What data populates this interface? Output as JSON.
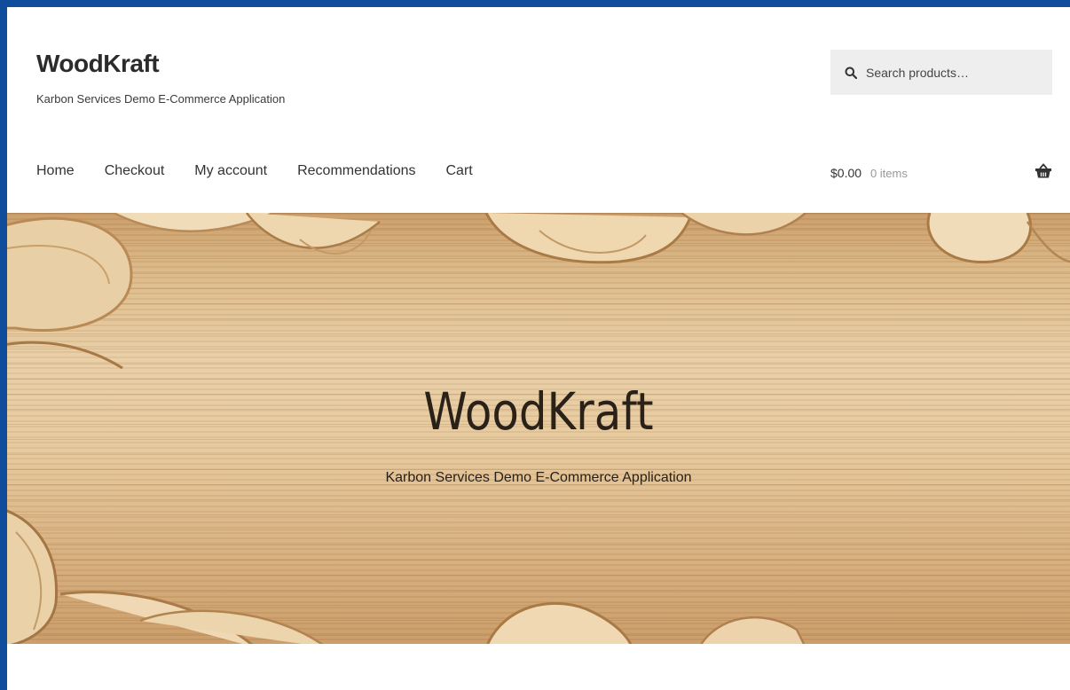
{
  "site": {
    "title": "WoodKraft",
    "description": "Karbon Services Demo E-Commerce Application"
  },
  "search": {
    "placeholder": "Search products…",
    "icon": "search-icon"
  },
  "nav": {
    "items": [
      {
        "label": "Home"
      },
      {
        "label": "Checkout"
      },
      {
        "label": "My account"
      },
      {
        "label": "Recommendations"
      },
      {
        "label": "Cart"
      }
    ]
  },
  "cart": {
    "amount": "$0.00",
    "count": "0 items",
    "icon": "basket-icon"
  },
  "hero": {
    "title": "WoodKraft",
    "subtitle": "Karbon Services Demo E-Commerce Application"
  },
  "colors": {
    "frame": "#0f4c9c",
    "search_bg": "#eeeeee",
    "wood": "#e6c89c"
  }
}
